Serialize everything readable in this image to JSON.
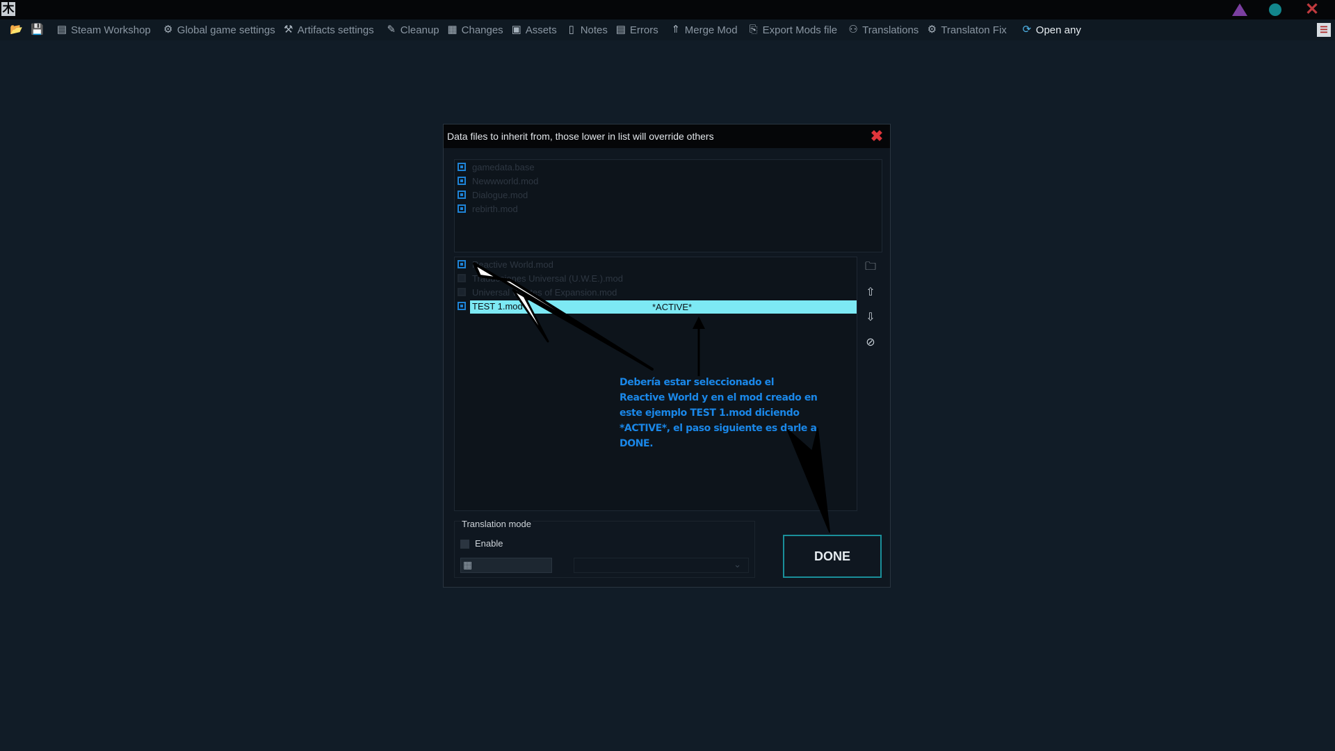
{
  "titlebar": {
    "app_icon": "木"
  },
  "toolbar": {
    "items": [
      {
        "icon": "open-folder-icon",
        "label": ""
      },
      {
        "icon": "save-icon",
        "label": ""
      },
      {
        "icon": "steam-icon",
        "label": "Steam Workshop"
      },
      {
        "icon": "gear-icon",
        "label": "Global game settings"
      },
      {
        "icon": "artifact-icon",
        "label": "Artifacts settings"
      },
      {
        "icon": "broom-icon",
        "label": "Cleanup"
      },
      {
        "icon": "changes-icon",
        "label": "Changes"
      },
      {
        "icon": "assets-icon",
        "label": "Assets"
      },
      {
        "icon": "notes-icon",
        "label": "Notes"
      },
      {
        "icon": "errors-icon",
        "label": "Errors"
      },
      {
        "icon": "merge-icon",
        "label": "Merge Mod"
      },
      {
        "icon": "export-icon",
        "label": "Export Mods file"
      },
      {
        "icon": "translate-icon",
        "label": "Translations"
      },
      {
        "icon": "translate-fix-icon",
        "label": "Translaton Fix"
      },
      {
        "icon": "link-icon",
        "label": "Open any"
      }
    ]
  },
  "dialog": {
    "title": "Data files to inherit from, those lower in list will override others",
    "base_files": [
      {
        "name": "gamedata.base",
        "checked": true
      },
      {
        "name": "Newwworld.mod",
        "checked": true
      },
      {
        "name": "Dialogue.mod",
        "checked": true
      },
      {
        "name": "rebirth.mod",
        "checked": true
      }
    ],
    "mod_files": [
      {
        "name": "Reactive World.mod",
        "checked": true
      },
      {
        "name": "Traducciones Universal (U.W.E.).mod",
        "checked": false
      },
      {
        "name": "Universal Wastes of Expansion.mod",
        "checked": false
      },
      {
        "name": "TEST 1.mod",
        "checked": true,
        "active": true,
        "tag": "*ACTIVE*"
      }
    ],
    "side_buttons": [
      "add-file-icon",
      "move-up-icon",
      "move-down-icon",
      "remove-file-icon"
    ],
    "annotation": "Debería estar seleccionado el Reactive World y en el mod creado en este ejemplo TEST 1.mod diciendo *ACTIVE*, el paso siguiente es darle a DONE.",
    "translation": {
      "group_title": "Translation mode",
      "enable_label": "Enable",
      "enabled": false,
      "language_value": ""
    },
    "done_label": "DONE"
  },
  "colors": {
    "background": "#111c27",
    "checkbox": "#1e83d6",
    "active_row": "#7de9f4",
    "annotation": "#1a87e8",
    "done_border": "#1a8f9a",
    "close": "#e0353b"
  }
}
